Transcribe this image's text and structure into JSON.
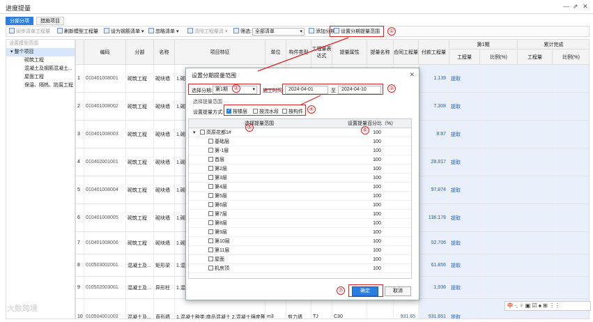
{
  "window": {
    "title": "进度提量",
    "controls": [
      "—",
      "⇗",
      "✕"
    ]
  },
  "tabs": [
    {
      "label": "分部分项",
      "active": true
    },
    {
      "label": "措施项目",
      "active": false
    }
  ],
  "toolbar": {
    "sync_label": "同步清单工程量",
    "refresh_label": "刷新模型工程量",
    "set_rebar_label": "设为钢筋清单 ▾",
    "cancel_list_label": "忽略清单 ▾",
    "clear_qty_label": "清除工程量清 ▾",
    "filter_label": "筛选:",
    "filter_value": "全部清单",
    "add_period_label": "添加分期",
    "set_range_label": "设置分期提量范围"
  },
  "left_panel": {
    "header": "设置模型范围",
    "items": [
      {
        "label": "▾ 整个项目",
        "selected": true
      },
      {
        "label": "砌筑工程",
        "selected": false
      },
      {
        "label": "混凝土及钢筋混凝土...",
        "selected": false
      },
      {
        "label": "屋面工程",
        "selected": false
      },
      {
        "label": "保温、隔热、防腐工程",
        "selected": false
      }
    ]
  },
  "grid": {
    "headers": {
      "code": "编码",
      "division": "分部",
      "name": "名称",
      "feature": "项目特征",
      "unit": "单位",
      "comp_type": "构件类型",
      "expr": "工程量表达式",
      "attr": "提量属性",
      "attr_name": "提量名称",
      "contract_qty": "合同工程量",
      "paid_qty": "付款工程量",
      "period1": "第1期",
      "cumulative": "累计完成",
      "p1_qty": "工程量",
      "p1_ratio": "比例(%)",
      "cum_qty": "工程量",
      "cum_ratio": "比例(%)"
    },
    "rows": [
      {
        "no": "1",
        "code": "010401008001",
        "division": "砌筑工程",
        "name": "砌块墙",
        "feature": "1.砌块品种、规格、强度等级...",
        "paid": "1.139",
        "link": "提取"
      },
      {
        "no": "2",
        "code": "010401008002",
        "division": "砌筑工程",
        "name": "砌块墙",
        "feature": "1.砌块品种、规格...",
        "paid": "7.308",
        "link": "提取"
      },
      {
        "no": "3",
        "code": "010401008003",
        "division": "砌筑工程",
        "name": "砌块墙",
        "feature": "1.砌块品种、规格...",
        "paid": "8.87",
        "link": "提取"
      },
      {
        "no": "4",
        "code": "010402001001",
        "division": "砌筑工程",
        "name": "砌块墙",
        "feature": "1.砌块品种...",
        "paid": "28.817",
        "link": "提取"
      },
      {
        "no": "5",
        "code": "010401008004",
        "division": "砌筑工程",
        "name": "砌块墙",
        "feature": "1.砌块品种...",
        "paid": "97.874",
        "link": "提取"
      },
      {
        "no": "6",
        "code": "010401008005",
        "division": "砌筑工程",
        "name": "砌块墙",
        "feature": "1.砌块品种...",
        "paid": "136.178",
        "link": "提取"
      },
      {
        "no": "7",
        "code": "010401008006",
        "division": "砌筑工程",
        "name": "砌块墙",
        "feature": "1.砌块品种...",
        "paid": "52.706",
        "link": "提取"
      },
      {
        "no": "8",
        "code": "010503002001",
        "division": "混凝土及...",
        "name": "矩形梁",
        "feature": "1.混凝土种类...",
        "paid": "61.856",
        "link": "提取"
      },
      {
        "no": "9",
        "code": "010502003001",
        "division": "混凝土及...",
        "name": "异形柱",
        "feature": "1.混凝土种类...",
        "paid": "1.936",
        "link": "提取"
      },
      {
        "no": "10",
        "code": "010504001002",
        "division": "混凝土及...",
        "name": "直形墙",
        "feature": "1.混凝土种类:商品混凝土 2.混凝土强度等级:C30",
        "unit": "m3",
        "comp": "剪力墙",
        "expr": "TJ",
        "attr": "C30",
        "contract": "931.65",
        "paid": "931.651",
        "link": "提取"
      }
    ]
  },
  "dialog": {
    "title": "设置分期提量范围",
    "period_label": "选择分期:",
    "period_value": "第1期",
    "time_label": "施工时间:",
    "date_from": "2024-04-01",
    "date_to_label": "至",
    "date_to": "2024-04-10",
    "range_group_label": "选择提量范围",
    "method_label": "设置提量方式:",
    "methods": [
      {
        "label": "按楼层",
        "checked": true
      },
      {
        "label": "按流水段",
        "checked": false
      },
      {
        "label": "按构件",
        "checked": false
      }
    ],
    "table_header_name": "选择提量范围",
    "table_header_pct": "设置提量百分比（%）",
    "root": {
      "label": "高原花都1#",
      "value": "100"
    },
    "floors": [
      {
        "label": "基础层",
        "value": "100"
      },
      {
        "label": "第-1层",
        "value": "100"
      },
      {
        "label": "首层",
        "value": "100"
      },
      {
        "label": "第2层",
        "value": "100"
      },
      {
        "label": "第3层",
        "value": "100"
      },
      {
        "label": "第4层",
        "value": "100"
      },
      {
        "label": "第5层",
        "value": "100"
      },
      {
        "label": "第6层",
        "value": "100"
      },
      {
        "label": "第7层",
        "value": "100"
      },
      {
        "label": "第8层",
        "value": "100"
      },
      {
        "label": "第9层",
        "value": "100"
      },
      {
        "label": "第10层",
        "value": "100"
      },
      {
        "label": "第11层",
        "value": "100"
      },
      {
        "label": "屋面",
        "value": "100"
      },
      {
        "label": "机房顶",
        "value": "100"
      }
    ],
    "ok_label": "确定",
    "cancel_label": "取消"
  },
  "annotations": [
    "①",
    "②",
    "③",
    "④",
    "⑤",
    "⑥",
    "⑦"
  ],
  "ime": {
    "label": "中",
    "symbols": "·, ♀ ▣ ☑ ♠ ⊞ ⋮⋮"
  },
  "watermark": "大数跨境",
  "colors": {
    "accent": "#2a7de1",
    "annotation": "#e02020"
  }
}
